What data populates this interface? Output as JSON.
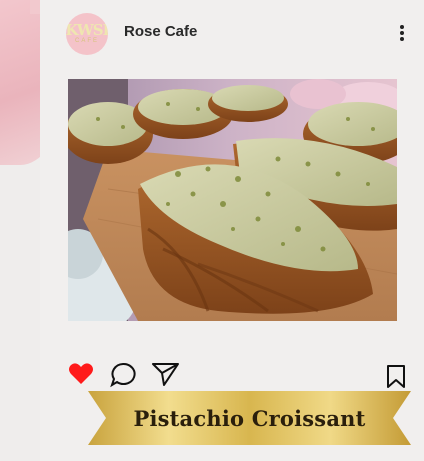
{
  "post": {
    "account_name": "Rose Cafe",
    "avatar": {
      "logo_text": "KWSI",
      "logo_subtext": "CAFE"
    },
    "menu_icon": "more-vertical-icon",
    "photo": {
      "subject": "pistachio croissants on wooden board"
    },
    "actions": {
      "like_icon": "heart-icon",
      "like_color": "#ff1a1a",
      "comment_icon": "comment-icon",
      "share_icon": "send-icon",
      "save_icon": "bookmark-icon"
    },
    "caption": "Pistachio Croissant"
  },
  "colors": {
    "background": "#efedec",
    "splash_pink": "#eab4bc",
    "banner_gold": "#d7b44a"
  }
}
